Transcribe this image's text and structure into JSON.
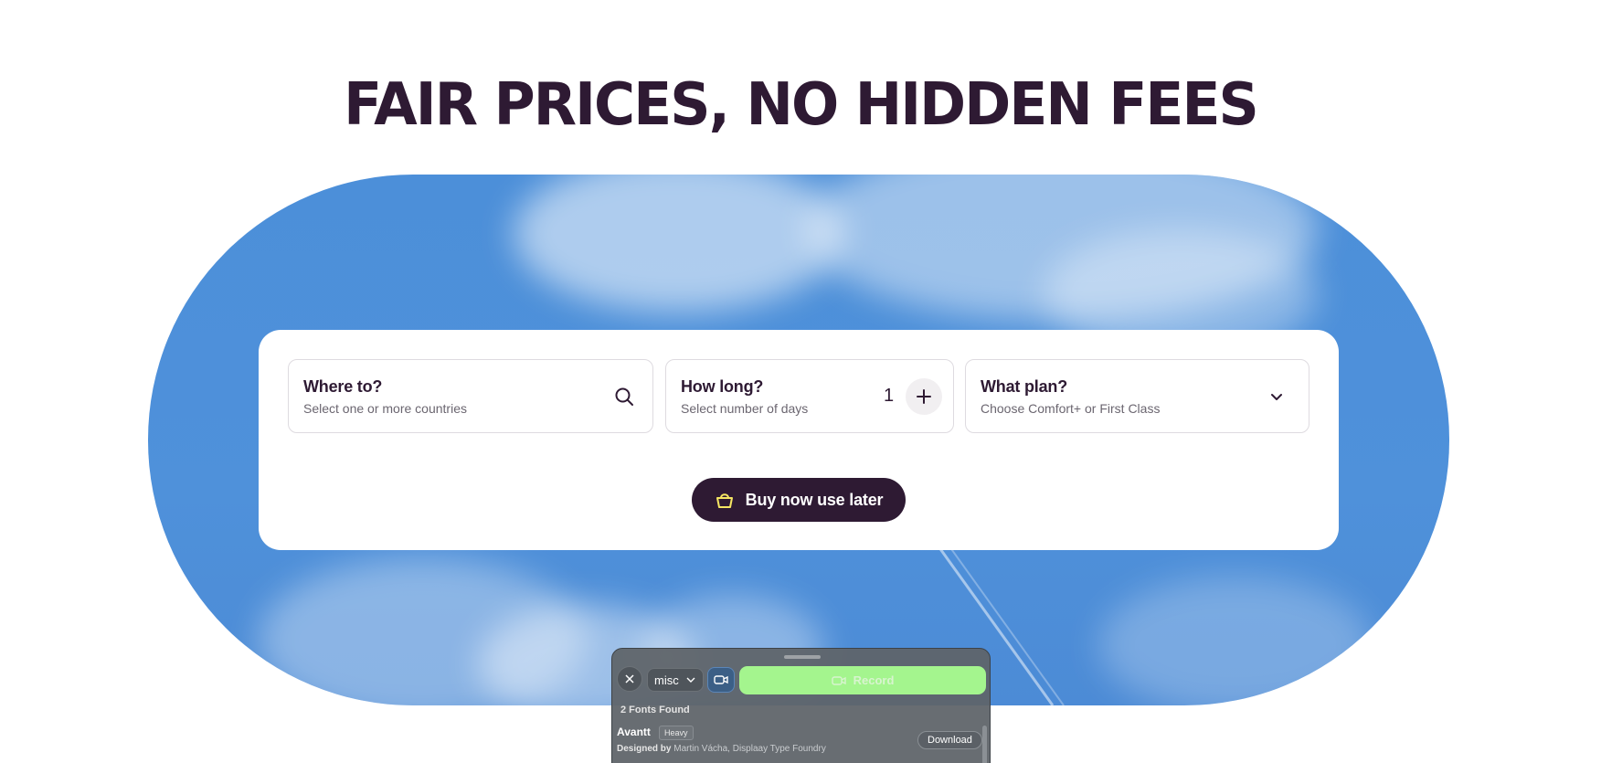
{
  "page": {
    "headline": "FAIR PRICES, NO HIDDEN FEES"
  },
  "booking": {
    "where": {
      "title": "Where to?",
      "subtitle": "Select one or more countries",
      "icon": "search-icon"
    },
    "how_long": {
      "title": "How long?",
      "subtitle": "Select number of days",
      "value": "1",
      "icon": "plus-icon"
    },
    "plan": {
      "title": "What plan?",
      "subtitle": "Choose Comfort+ or First Class",
      "icon": "chevron-down-icon"
    },
    "buy_button": {
      "label": "Buy now use later",
      "icon": "basket-icon"
    }
  },
  "recorder": {
    "category": "misc",
    "record_label": "Record",
    "fonts_found": "2 Fonts Found",
    "font": {
      "name": "Avantt",
      "weight_badge": "Heavy",
      "designed_by_label": "Designed by",
      "designer": "Martin Vácha, Displaay Type Foundry",
      "download_label": "Download"
    }
  },
  "colors": {
    "brand_dark": "#2e1a33",
    "sky_blue": "#4c8fd9",
    "record_green": "#a4f58e",
    "basket_yellow": "#f5e663"
  }
}
